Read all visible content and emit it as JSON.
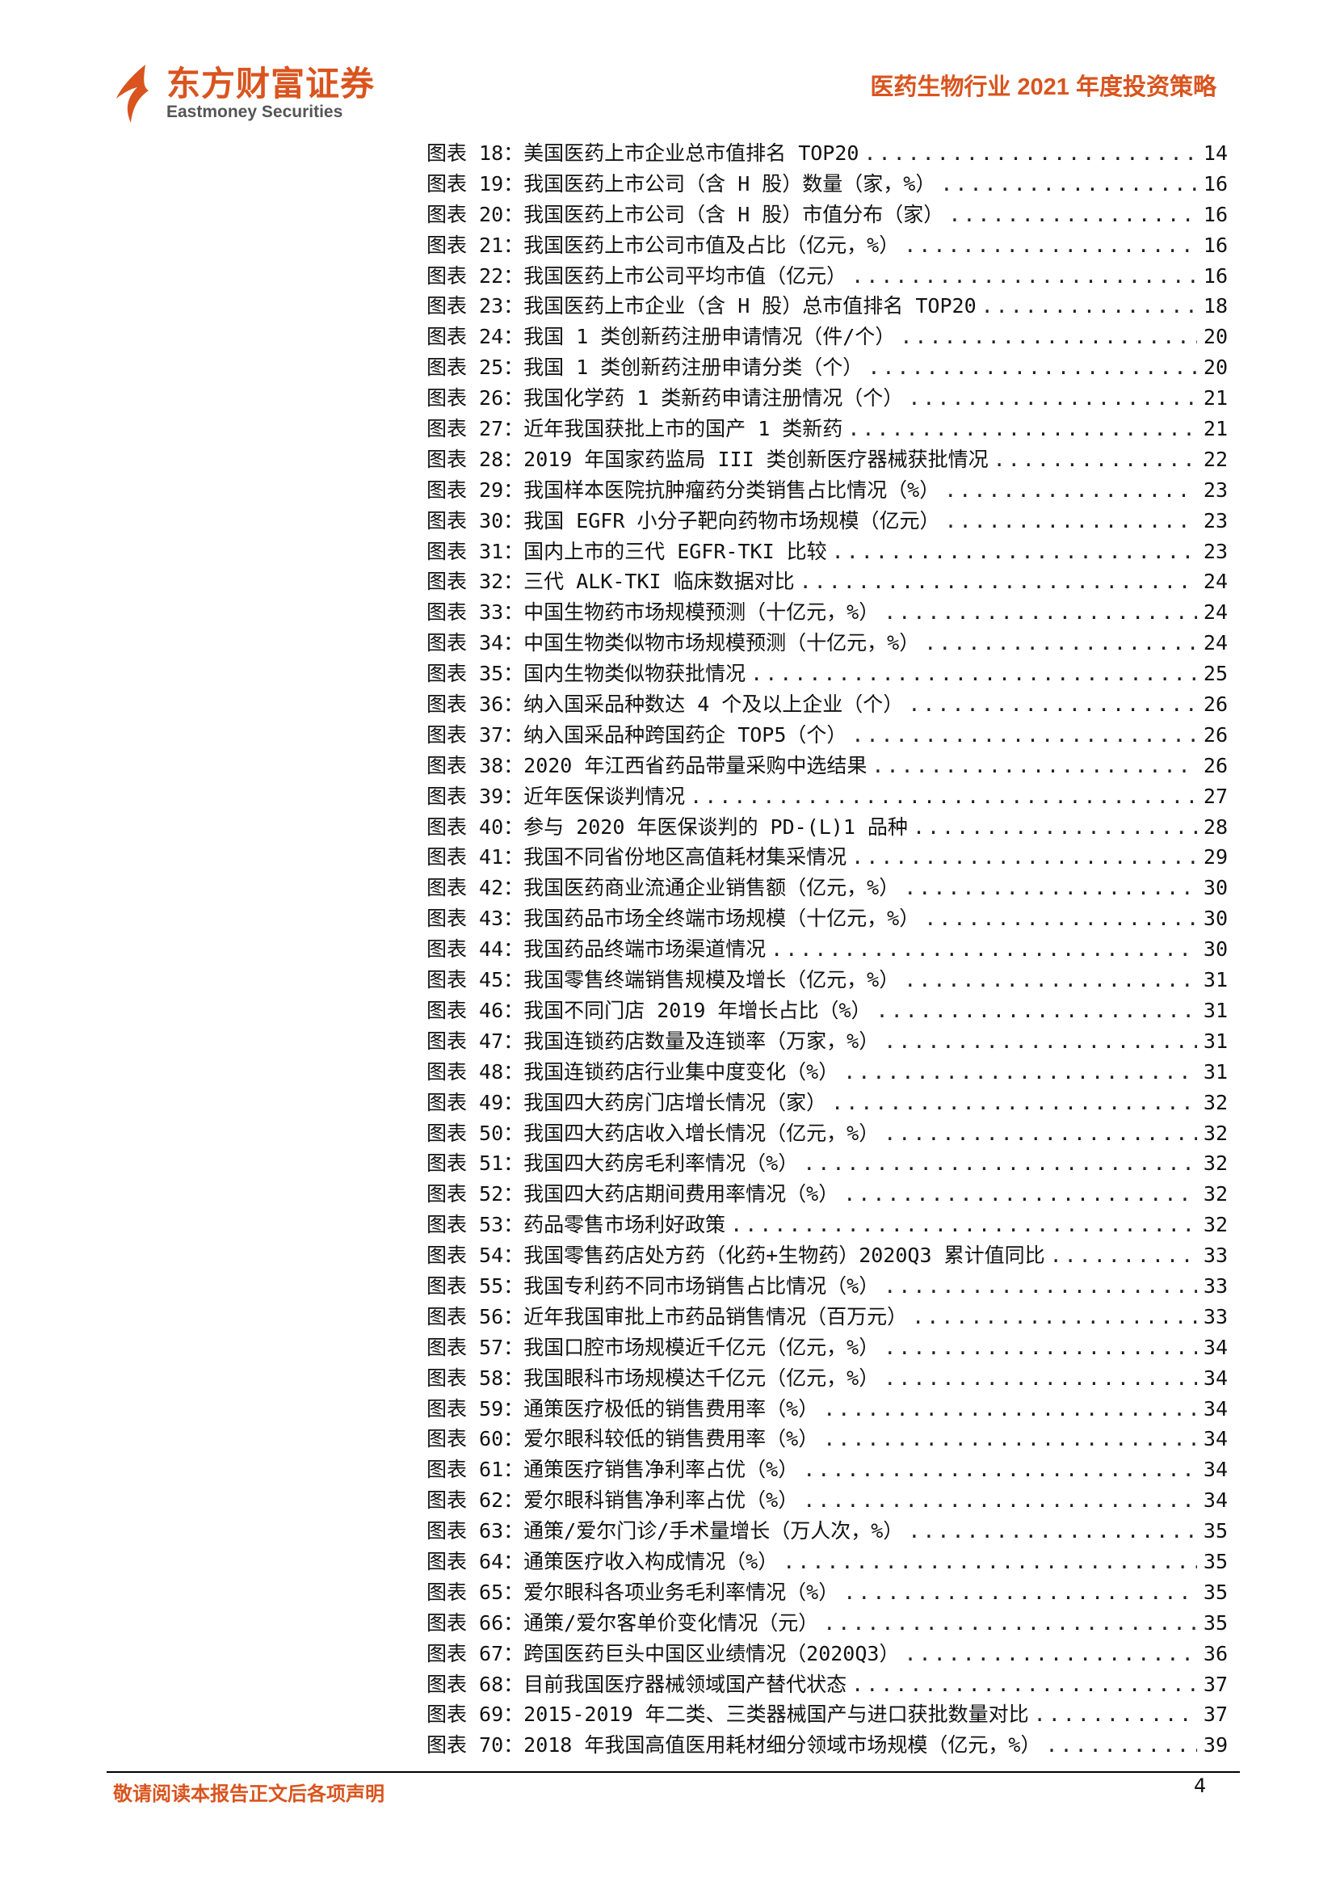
{
  "header": {
    "logo_cn": "东方财富证券",
    "logo_en": "Eastmoney Securities",
    "doc_title": "医药生物行业 2021 年度投资策略"
  },
  "colors": {
    "brand": "#d9541e"
  },
  "toc": [
    {
      "label": "图表 18：美国医药上市企业总市值排名 TOP20",
      "page": "14"
    },
    {
      "label": "图表 19：我国医药上市公司（含 H 股）数量（家，%）",
      "page": "16"
    },
    {
      "label": "图表 20：我国医药上市公司（含 H 股）市值分布（家）",
      "page": "16"
    },
    {
      "label": "图表 21：我国医药上市公司市值及占比（亿元，%）",
      "page": "16"
    },
    {
      "label": "图表 22：我国医药上市公司平均市值（亿元）",
      "page": "16"
    },
    {
      "label": "图表 23：我国医药上市企业（含 H 股）总市值排名 TOP20",
      "page": "18"
    },
    {
      "label": "图表 24：我国 1 类创新药注册申请情况（件/个）",
      "page": "20"
    },
    {
      "label": "图表 25：我国 1 类创新药注册申请分类（个）",
      "page": "20"
    },
    {
      "label": "图表 26：我国化学药 1 类新药申请注册情况（个）",
      "page": "21"
    },
    {
      "label": "图表 27：近年我国获批上市的国产 1 类新药",
      "page": "21"
    },
    {
      "label": "图表 28：2019 年国家药监局 III 类创新医疗器械获批情况",
      "page": "22"
    },
    {
      "label": "图表 29：我国样本医院抗肿瘤药分类销售占比情况（%）",
      "page": "23"
    },
    {
      "label": "图表 30：我国 EGFR 小分子靶向药物市场规模（亿元）",
      "page": "23"
    },
    {
      "label": "图表 31：国内上市的三代 EGFR-TKI 比较",
      "page": "23"
    },
    {
      "label": "图表 32：三代 ALK-TKI 临床数据对比",
      "page": "24"
    },
    {
      "label": "图表 33：中国生物药市场规模预测（十亿元，%）",
      "page": "24"
    },
    {
      "label": "图表 34：中国生物类似物市场规模预测（十亿元，%）",
      "page": "24"
    },
    {
      "label": "图表 35：国内生物类似物获批情况",
      "page": "25"
    },
    {
      "label": "图表 36：纳入国采品种数达 4 个及以上企业（个）",
      "page": "26"
    },
    {
      "label": "图表 37：纳入国采品种跨国药企 TOP5（个）",
      "page": "26"
    },
    {
      "label": "图表 38：2020 年江西省药品带量采购中选结果",
      "page": "26"
    },
    {
      "label": "图表 39：近年医保谈判情况",
      "page": "27"
    },
    {
      "label": "图表 40：参与 2020 年医保谈判的 PD-(L)1 品种",
      "page": "28"
    },
    {
      "label": "图表 41：我国不同省份地区高值耗材集采情况",
      "page": "29"
    },
    {
      "label": "图表 42：我国医药商业流通企业销售额（亿元，%）",
      "page": "30"
    },
    {
      "label": "图表 43：我国药品市场全终端市场规模（十亿元，%）",
      "page": "30"
    },
    {
      "label": "图表 44：我国药品终端市场渠道情况",
      "page": "30"
    },
    {
      "label": "图表 45：我国零售终端销售规模及增长（亿元，%）",
      "page": "31"
    },
    {
      "label": "图表 46：我国不同门店 2019 年增长占比（%）",
      "page": "31"
    },
    {
      "label": "图表 47：我国连锁药店数量及连锁率（万家，%）",
      "page": "31"
    },
    {
      "label": "图表 48：我国连锁药店行业集中度变化（%）",
      "page": "31"
    },
    {
      "label": "图表 49：我国四大药房门店增长情况（家）",
      "page": "32"
    },
    {
      "label": "图表 50：我国四大药店收入增长情况（亿元，%）",
      "page": "32"
    },
    {
      "label": "图表 51：我国四大药房毛利率情况（%）",
      "page": "32"
    },
    {
      "label": "图表 52：我国四大药店期间费用率情况（%）",
      "page": "32"
    },
    {
      "label": "图表 53：药品零售市场利好政策",
      "page": "32"
    },
    {
      "label": "图表 54：我国零售药店处方药（化药+生物药）2020Q3 累计值同比",
      "page": "33"
    },
    {
      "label": "图表 55：我国专利药不同市场销售占比情况（%）",
      "page": "33"
    },
    {
      "label": "图表 56：近年我国审批上市药品销售情况（百万元）",
      "page": "33"
    },
    {
      "label": "图表 57：我国口腔市场规模近千亿元（亿元，%）",
      "page": "34"
    },
    {
      "label": "图表 58：我国眼科市场规模达千亿元（亿元，%）",
      "page": "34"
    },
    {
      "label": "图表 59：通策医疗极低的销售费用率（%）",
      "page": "34"
    },
    {
      "label": "图表 60：爱尔眼科较低的销售费用率（%）",
      "page": "34"
    },
    {
      "label": "图表 61：通策医疗销售净利率占优（%）",
      "page": "34"
    },
    {
      "label": "图表 62：爱尔眼科销售净利率占优（%）",
      "page": "34"
    },
    {
      "label": "图表 63：通策/爱尔门诊/手术量增长（万人次，%）",
      "page": "35"
    },
    {
      "label": "图表 64：通策医疗收入构成情况（%）",
      "page": "35"
    },
    {
      "label": "图表 65：爱尔眼科各项业务毛利率情况（%）",
      "page": "35"
    },
    {
      "label": "图表 66：通策/爱尔客单价变化情况（元）",
      "page": "35"
    },
    {
      "label": "图表 67：跨国医药巨头中国区业绩情况（2020Q3）",
      "page": "36"
    },
    {
      "label": "图表 68：目前我国医疗器械领域国产替代状态",
      "page": "37"
    },
    {
      "label": "图表 69：2015-2019 年二类、三类器械国产与进口获批数量对比",
      "page": "37"
    },
    {
      "label": "图表 70：2018 年我国高值医用耗材细分领域市场规模（亿元，%）",
      "page": "39"
    }
  ],
  "footer": {
    "disclaimer": "敬请阅读本报告正文后各项声明",
    "page_number": "4"
  }
}
